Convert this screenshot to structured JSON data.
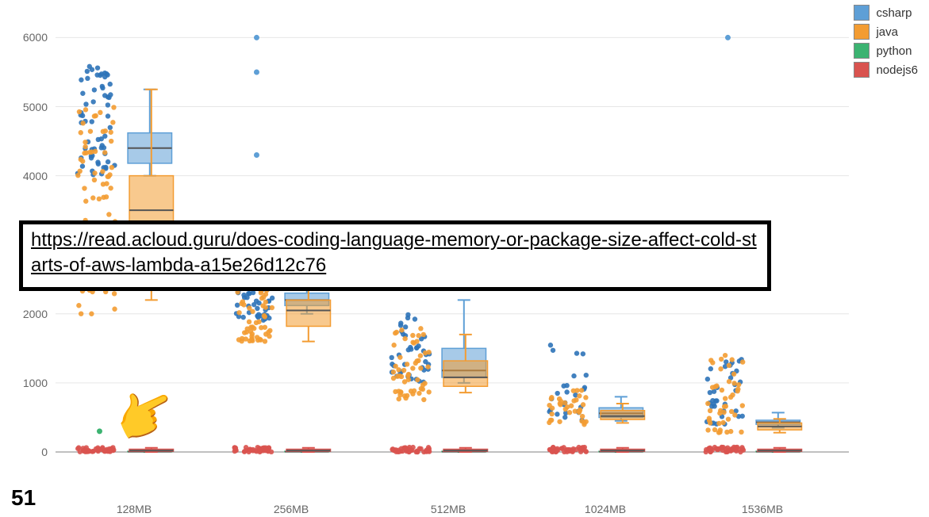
{
  "slide_number": "51",
  "url_text": "https://read.acloud.guru/does-coding-language-memory-or-package-size-affect-cold-starts-of-aws-lambda-a15e26d12c76",
  "pointer_emoji": "👈",
  "legend": [
    {
      "label": "csharp",
      "color": "#5e9fd6"
    },
    {
      "label": "java",
      "color": "#f39c32"
    },
    {
      "label": "python",
      "color": "#3cb371"
    },
    {
      "label": "nodejs6",
      "color": "#d9534f"
    }
  ],
  "chart_data": {
    "type": "box",
    "xlabel": "",
    "ylabel": "",
    "ylim": [
      0,
      6200
    ],
    "y_ticks": [
      0,
      1000,
      2000,
      4000,
      5000,
      6000
    ],
    "categories": [
      "128MB",
      "256MB",
      "512MB",
      "1024MB",
      "1536MB"
    ],
    "series": [
      {
        "name": "csharp",
        "color": "#5e9fd6",
        "boxes": [
          {
            "low": 4000,
            "q1": 4180,
            "median": 4400,
            "q3": 4620,
            "high": 5250
          },
          {
            "low": 2000,
            "q1": 2120,
            "median": 2200,
            "q3": 2300,
            "high": 2400
          },
          {
            "low": 1000,
            "q1": 1080,
            "median": 1180,
            "q3": 1500,
            "high": 2200
          },
          {
            "low": 450,
            "q1": 500,
            "median": 560,
            "q3": 640,
            "high": 800
          },
          {
            "low": 350,
            "q1": 400,
            "median": 430,
            "q3": 460,
            "high": 570
          }
        ],
        "outliers": [
          {
            "cat": "256MB",
            "y": 6000
          },
          {
            "cat": "256MB",
            "y": 5500
          },
          {
            "cat": "256MB",
            "y": 4300
          },
          {
            "cat": "1536MB",
            "y": 6000
          }
        ]
      },
      {
        "name": "java",
        "color": "#f39c32",
        "boxes": [
          {
            "low": 2200,
            "q1": 3200,
            "median": 3500,
            "q3": 4000,
            "high": 5250
          },
          {
            "low": 1600,
            "q1": 1820,
            "median": 2050,
            "q3": 2200,
            "high": 2420
          },
          {
            "low": 860,
            "q1": 950,
            "median": 1080,
            "q3": 1320,
            "high": 1700
          },
          {
            "low": 420,
            "q1": 470,
            "median": 520,
            "q3": 600,
            "high": 700
          },
          {
            "low": 280,
            "q1": 320,
            "median": 370,
            "q3": 420,
            "high": 480
          }
        ],
        "outliers": []
      },
      {
        "name": "python",
        "color": "#3cb371",
        "boxes": [
          {
            "low": 0,
            "q1": 2,
            "median": 5,
            "q3": 10,
            "high": 20
          },
          {
            "low": 0,
            "q1": 2,
            "median": 5,
            "q3": 10,
            "high": 20
          },
          {
            "low": 0,
            "q1": 2,
            "median": 5,
            "q3": 10,
            "high": 20
          },
          {
            "low": 0,
            "q1": 2,
            "median": 5,
            "q3": 10,
            "high": 20
          },
          {
            "low": 0,
            "q1": 2,
            "median": 5,
            "q3": 10,
            "high": 20
          }
        ],
        "outliers": [
          {
            "cat": "128MB",
            "y": 300
          }
        ]
      },
      {
        "name": "nodejs6",
        "color": "#d9534f",
        "boxes": [
          {
            "low": 0,
            "q1": 10,
            "median": 20,
            "q3": 40,
            "high": 60
          },
          {
            "low": 0,
            "q1": 10,
            "median": 20,
            "q3": 40,
            "high": 60
          },
          {
            "low": 0,
            "q1": 10,
            "median": 20,
            "q3": 40,
            "high": 60
          },
          {
            "low": 0,
            "q1": 10,
            "median": 20,
            "q3": 40,
            "high": 60
          },
          {
            "low": 0,
            "q1": 10,
            "median": 20,
            "q3": 40,
            "high": 60
          }
        ],
        "outliers": []
      }
    ],
    "point_swarms": [
      {
        "name": "csharp",
        "color": "#2e73b8",
        "clusters": [
          {
            "cat": "128MB",
            "ymin": 4000,
            "ymax": 5700,
            "count": 60
          },
          {
            "cat": "256MB",
            "ymin": 1900,
            "ymax": 2500,
            "count": 45
          },
          {
            "cat": "512MB",
            "ymin": 1000,
            "ymax": 2000,
            "count": 40
          },
          {
            "cat": "1024MB",
            "ymin": 450,
            "ymax": 1600,
            "count": 25
          },
          {
            "cat": "1536MB",
            "ymin": 400,
            "ymax": 1350,
            "count": 35
          }
        ]
      },
      {
        "name": "java",
        "color": "#f39c32",
        "clusters": [
          {
            "cat": "128MB",
            "ymin": 2000,
            "ymax": 5100,
            "count": 80
          },
          {
            "cat": "256MB",
            "ymin": 1600,
            "ymax": 2500,
            "count": 55
          },
          {
            "cat": "512MB",
            "ymin": 750,
            "ymax": 1800,
            "count": 55
          },
          {
            "cat": "1024MB",
            "ymin": 380,
            "ymax": 900,
            "count": 35
          },
          {
            "cat": "1536MB",
            "ymin": 280,
            "ymax": 1400,
            "count": 45
          }
        ]
      },
      {
        "name": "nodejs6",
        "color": "#d9534f",
        "clusters": [
          {
            "cat": "128MB",
            "ymin": 0,
            "ymax": 70,
            "count": 40
          },
          {
            "cat": "256MB",
            "ymin": 0,
            "ymax": 70,
            "count": 40
          },
          {
            "cat": "512MB",
            "ymin": 0,
            "ymax": 70,
            "count": 40
          },
          {
            "cat": "1024MB",
            "ymin": 0,
            "ymax": 70,
            "count": 40
          },
          {
            "cat": "1536MB",
            "ymin": 0,
            "ymax": 70,
            "count": 40
          }
        ]
      }
    ]
  }
}
